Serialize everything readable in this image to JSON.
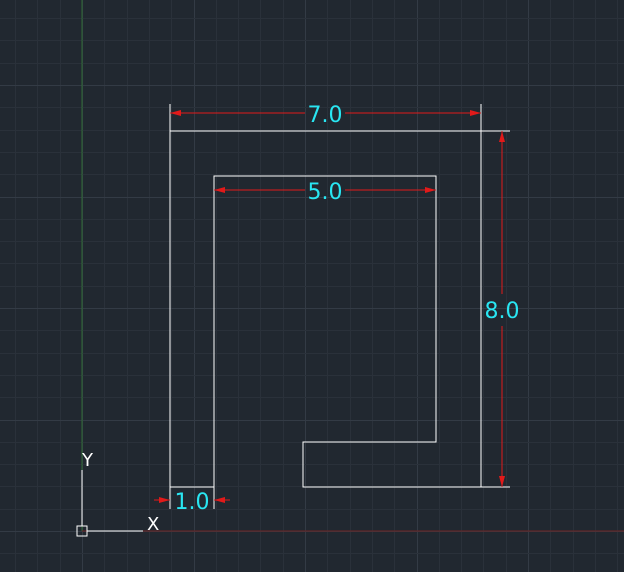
{
  "colors": {
    "background": "#212830",
    "grid_minor": "#2a313a",
    "grid_major": "#333b45",
    "axis_y": "#2f6b35",
    "axis_x": "#6e2323",
    "geometry": "#ffffff",
    "dim_line": "#e11a1a",
    "dim_text": "#29e6f2",
    "ucs": "#ffffff"
  },
  "ucs": {
    "x_label": "X",
    "y_label": "Y"
  },
  "dimensions": {
    "outer_width": "7.0",
    "inner_width": "5.0",
    "height": "8.0",
    "wall": "1.0"
  }
}
